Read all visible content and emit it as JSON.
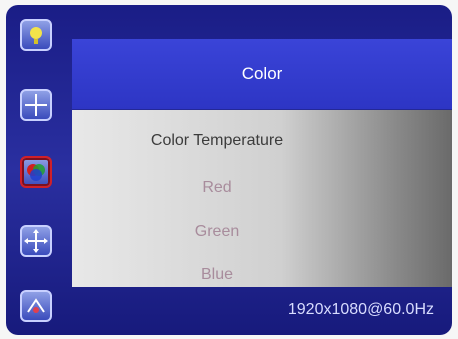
{
  "window": {
    "title": "Color"
  },
  "sidebar": {
    "items": [
      {
        "icon": "brightness-icon",
        "selected": false
      },
      {
        "icon": "position-icon",
        "selected": false
      },
      {
        "icon": "color-icon",
        "selected": true
      },
      {
        "icon": "image-setup-icon",
        "selected": false
      },
      {
        "icon": "input-source-icon",
        "selected": false
      }
    ]
  },
  "menu": {
    "items": [
      {
        "label": "Color Temperature",
        "state": "active"
      },
      {
        "label": "Red",
        "state": "normal"
      },
      {
        "label": "Green",
        "state": "normal"
      },
      {
        "label": "Blue",
        "state": "normal"
      }
    ]
  },
  "status": {
    "resolution": "1920x1080@60.0Hz"
  },
  "colors": {
    "accent": "#2d35c4",
    "selection": "#d0202a"
  }
}
